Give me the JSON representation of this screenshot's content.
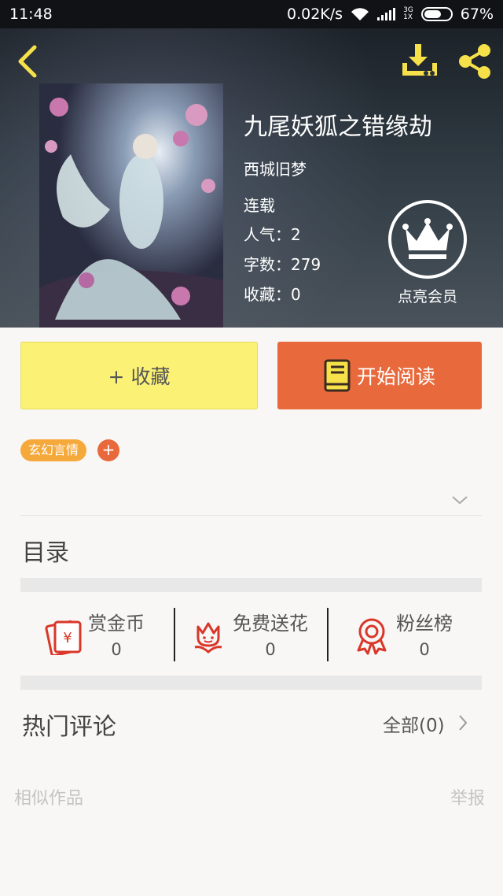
{
  "status_bar": {
    "time": "11:48",
    "speed": "0.02K/s",
    "network_top": "3G",
    "network_bottom": "1X",
    "battery": "67%"
  },
  "header": {
    "back_icon": "chevron-left-icon",
    "download_icon": "download-icon",
    "share_icon": "share-icon",
    "accent_color": "#f7e14a"
  },
  "book": {
    "title": "九尾妖狐之错缘劫",
    "author": "西城旧梦",
    "status": "连载",
    "popularity": "人气：2",
    "word_count": "字数：279",
    "favorites": "收藏：0"
  },
  "vip": {
    "label": "点亮会员",
    "icon": "crown-icon"
  },
  "actions": {
    "collect_label": "+ 收藏",
    "read_label": "开始阅读",
    "collect_color": "#fbf175",
    "read_color": "#e86a3c"
  },
  "tags": {
    "items": [
      "玄幻言情"
    ],
    "add_label": "+"
  },
  "catalog": {
    "title": "目录"
  },
  "stats": [
    {
      "label": "赏金币",
      "value": "0",
      "icon": "red-envelope-icon"
    },
    {
      "label": "免费送花",
      "value": "0",
      "icon": "flower-icon"
    },
    {
      "label": "粉丝榜",
      "value": "0",
      "icon": "medal-icon"
    }
  ],
  "comments": {
    "title": "热门评论",
    "all_label": "全部(0)"
  },
  "footer": {
    "similar_label": "相似作品",
    "report_label": "举报"
  }
}
